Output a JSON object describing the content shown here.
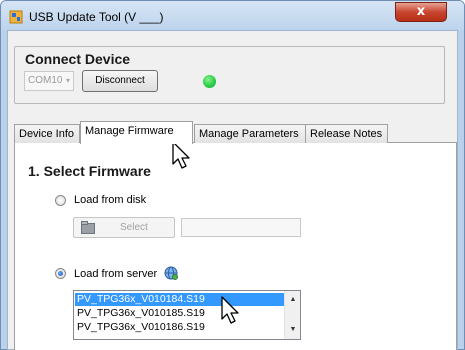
{
  "window": {
    "title": "USB Update Tool  (V ___)",
    "close_symbol": "x",
    "icon": "usb-app-icon"
  },
  "connect": {
    "title": "Connect Device",
    "port_value": "COM10",
    "port_arrow": "▾",
    "disconnect_label": "Disconnect",
    "status_color": "#22cc44"
  },
  "tabs": [
    {
      "label": "Device Info",
      "active": false
    },
    {
      "label": "Manage Firmware",
      "active": true
    },
    {
      "label": "Manage Parameters",
      "active": false
    },
    {
      "label": "Release Notes",
      "active": false
    }
  ],
  "firmware": {
    "section_title": "1. Select Firmware",
    "load_disk_label": "Load from disk",
    "load_disk_checked": false,
    "select_button_label": "Select",
    "path_value": "",
    "load_server_label": "Load from server",
    "load_server_checked": true,
    "server_icon": "network-globe-icon",
    "files": [
      {
        "name": "PV_TPG36x_V010184.S19",
        "selected": true
      },
      {
        "name": "PV_TPG36x_V010185.S19",
        "selected": false
      },
      {
        "name": "PV_TPG36x_V010186.S19",
        "selected": false
      }
    ],
    "scroll_up": "▲",
    "scroll_down": "▼"
  },
  "colors": {
    "selection": "#3399ff",
    "close_button": "#c7452f"
  }
}
